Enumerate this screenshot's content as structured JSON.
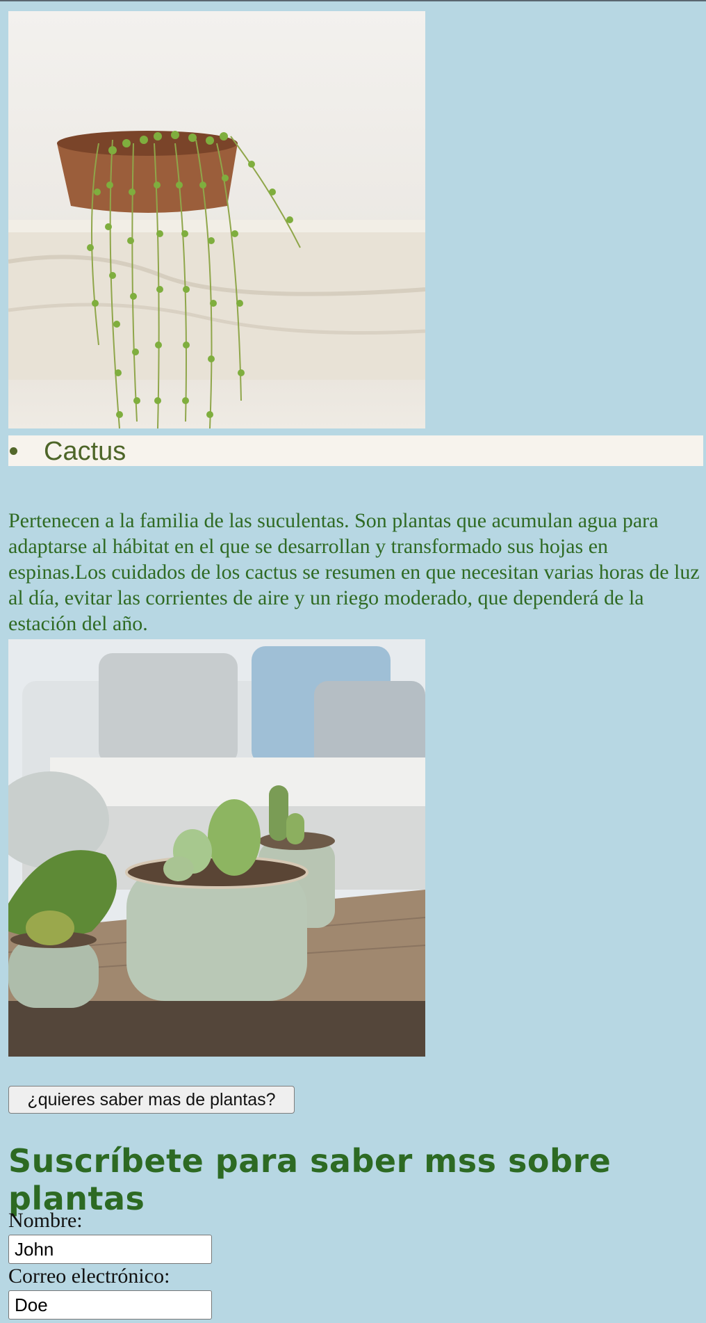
{
  "list": {
    "items": [
      {
        "label": "Cactus"
      }
    ]
  },
  "description": "Pertenecen a la familia de las suculentas. Son plantas que acumulan agua para adaptarse al hábitat en el que se desarrollan y transformado sus hojas en espinas.Los cuidados de los cactus se resumen en que necesitan varias horas de luz al día, evitar las corrientes de aire y un riego moderado, que dependerá de la estación del año.",
  "more_button": {
    "label": "¿quieres saber mas de plantas?"
  },
  "subscribe": {
    "title": "Suscríbete para saber mss sobre plantas",
    "name_label": "Nombre:",
    "name_value": "John",
    "email_label": "Correo electrónico:",
    "email_value": "Doe"
  },
  "colors": {
    "background": "#b7d7e3",
    "text_green": "#2f6a23",
    "list_bg": "#f7f3ed"
  }
}
